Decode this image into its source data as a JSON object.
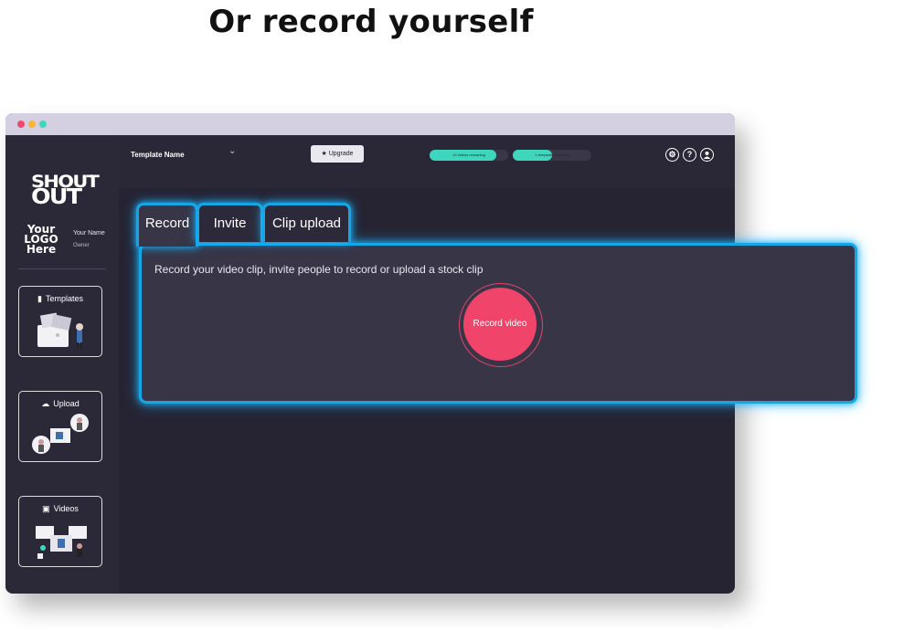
{
  "headline": "Or record yourself",
  "colors": {
    "accent": "#16a6e5",
    "record": "#f1446a",
    "progress": "#3fd6be",
    "dot_red": "#ef4a6a",
    "dot_yellow": "#f5b63a",
    "dot_green": "#3fd6be"
  },
  "sidebar": {
    "brand": {
      "line1": "SHOUT",
      "line2": "OUT",
      "mark": "®"
    },
    "logo_placeholder": [
      "Your",
      "LOGO",
      "Here"
    ],
    "user": {
      "name": "Your Name",
      "role": "Owner"
    },
    "items": [
      {
        "label": "Templates",
        "icon": "document-icon"
      },
      {
        "label": "Upload",
        "icon": "cloud-upload-icon"
      },
      {
        "label": "Videos",
        "icon": "video-folder-icon"
      }
    ]
  },
  "topbar": {
    "template_name": "Template Name",
    "template_chevron": "⌄",
    "upgrade_label": "Upgrade",
    "videos_remaining": {
      "text": "12 videos remaining",
      "fill": 0.85
    },
    "templates_remaining": {
      "text": "1 template remaining",
      "fill": 0.5
    },
    "icons": [
      "settings-icon",
      "help-icon",
      "user-icon"
    ]
  },
  "tabs": [
    {
      "label": "Record"
    },
    {
      "label": "Invite"
    },
    {
      "label": "Clip upload"
    }
  ],
  "panel": {
    "description": "Record your video clip, invite people to record or upload a stock clip",
    "record_button": "Record video"
  }
}
